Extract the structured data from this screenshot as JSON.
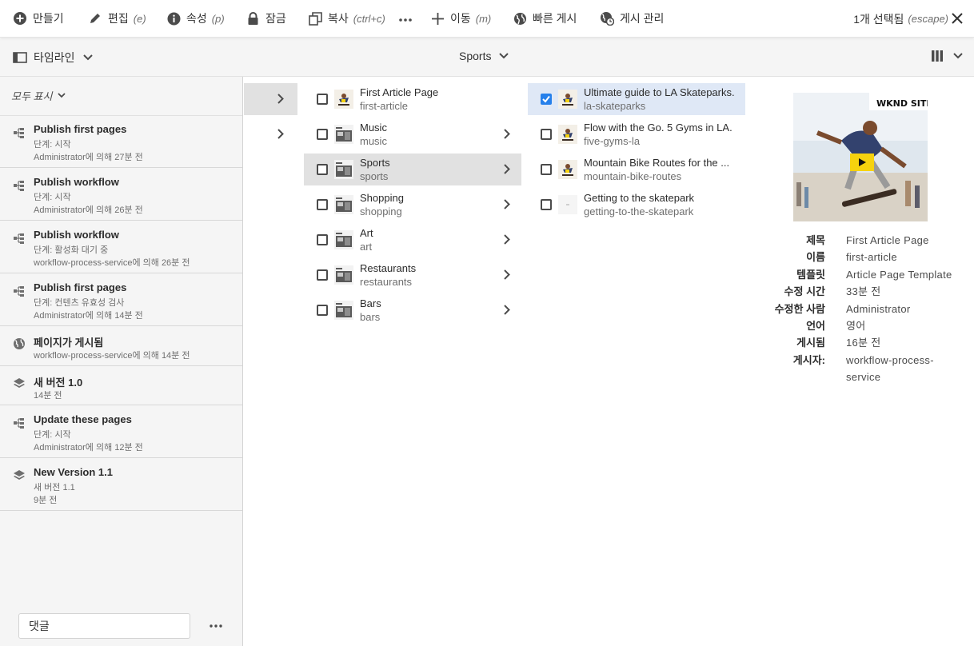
{
  "toolbar": {
    "create": "만들기",
    "edit": "편집",
    "edit_kb": "(e)",
    "properties": "속성",
    "properties_kb": "(p)",
    "lock": "잠금",
    "copy": "복사",
    "copy_kb": "(ctrl+c)",
    "move": "이동",
    "move_kb": "(m)",
    "quick_publish": "빠른 게시",
    "manage_publication": "게시 관리",
    "selection_count": "1개 선택됨",
    "selection_kb": "(escape)"
  },
  "subheader": {
    "rail_label": "타임라인",
    "breadcrumb": "Sports"
  },
  "rail": {
    "filter": "모두 표시",
    "comment_placeholder": "댓글",
    "items": [
      {
        "icon": "workflow-icon",
        "title": "Publish first pages",
        "lines": [
          "단계: 시작",
          "Administrator에 의해 27분 전"
        ]
      },
      {
        "icon": "workflow-icon",
        "title": "Publish workflow",
        "lines": [
          "단계: 시작",
          "Administrator에 의해 26분 전"
        ]
      },
      {
        "icon": "workflow-icon",
        "title": "Publish workflow",
        "lines": [
          "단계: 활성화 대기 중",
          "workflow-process-service에 의해 26분 전"
        ]
      },
      {
        "icon": "workflow-icon",
        "title": "Publish first pages",
        "lines": [
          "단계: 컨텐츠 유효성 검사",
          "Administrator에 의해 14분 전"
        ]
      },
      {
        "icon": "globe-icon",
        "title": "페이지가 게시됨",
        "lines": [
          "workflow-process-service에 의해 14분 전"
        ]
      },
      {
        "icon": "layers-icon",
        "title": "새 버전 1.0",
        "lines": [
          "14분 전"
        ]
      },
      {
        "icon": "workflow-icon",
        "title": "Update these pages",
        "lines": [
          "단계: 시작",
          "Administrator에 의해 12분 전"
        ]
      },
      {
        "icon": "layers-icon",
        "title": "New Version 1.1",
        "lines": [
          "새 버전 1.1",
          "9분 전"
        ]
      }
    ]
  },
  "column1": [
    {
      "title": "First Article Page",
      "name": "first-article",
      "has_children": false,
      "selected": false
    },
    {
      "title": "Music",
      "name": "music",
      "has_children": true,
      "selected": false
    },
    {
      "title": "Sports",
      "name": "sports",
      "has_children": true,
      "selected": true
    },
    {
      "title": "Shopping",
      "name": "shopping",
      "has_children": true,
      "selected": false
    },
    {
      "title": "Art",
      "name": "art",
      "has_children": true,
      "selected": false
    },
    {
      "title": "Restaurants",
      "name": "restaurants",
      "has_children": true,
      "selected": false
    },
    {
      "title": "Bars",
      "name": "bars",
      "has_children": true,
      "selected": false
    }
  ],
  "column2": [
    {
      "title": "Ultimate guide to LA Skateparks.",
      "name": "la-skateparks",
      "checked": true
    },
    {
      "title": "Flow with the Go. 5 Gyms in LA.",
      "name": "five-gyms-la",
      "checked": false
    },
    {
      "title": "Mountain Bike Routes for the ...",
      "name": "mountain-bike-routes",
      "checked": false
    },
    {
      "title": "Getting to the skatepark",
      "name": "getting-to-the-skatepark",
      "checked": false
    }
  ],
  "preview": {
    "image_brand": "WKND SITE",
    "meta": [
      {
        "key": "제목",
        "value": "First Article Page"
      },
      {
        "key": "이름",
        "value": "first-article"
      },
      {
        "key": "템플릿",
        "value": "Article Page Template"
      },
      {
        "key": "수정 시간",
        "value": "33분 전"
      },
      {
        "key": "수정한 사람",
        "value": "Administrator"
      },
      {
        "key": "언어",
        "value": "영어"
      },
      {
        "key": "게시됨",
        "value": "16분 전"
      },
      {
        "key": "게시자:",
        "value": "workflow-process-service"
      }
    ]
  },
  "colors": {
    "accent": "#2680eb",
    "selected_row": "#e1e1e1",
    "checked_row": "#dfe8f6",
    "rail_bg": "#f5f5f5"
  }
}
